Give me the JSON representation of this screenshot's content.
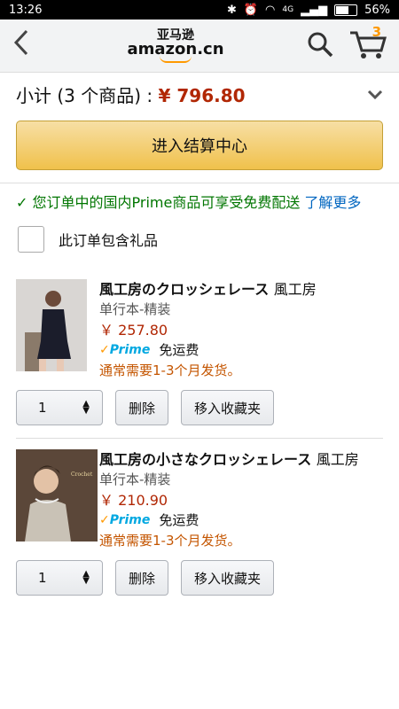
{
  "status": {
    "time": "13:26",
    "battery": "56%",
    "net": "4G"
  },
  "nav": {
    "logo_cn": "亚马逊",
    "logo_en": "amazon.cn",
    "cart_count": "3"
  },
  "subtotal": {
    "label": "小计 (3 个商品) : ",
    "amount": "¥ 796.80"
  },
  "checkout_label": "进入结算中心",
  "prime_note": {
    "text": "您订单中的国内Prime商品可享受免费配送",
    "link": "了解更多"
  },
  "gift_label": "此订单包含礼品",
  "items": [
    {
      "title": "風工房のクロッシェレース",
      "author": "風工房",
      "binding": "单行本-精装",
      "price": "￥ 257.80",
      "prime": "Prime",
      "shipping_free": "免运费",
      "ship_time": "通常需要1-3个月发货。",
      "qty": "1",
      "delete": "删除",
      "save": "移入收藏夹"
    },
    {
      "title": "風工房の小さなクロッシェレース",
      "author": "風工房",
      "binding": "单行本-精装",
      "price": "￥ 210.90",
      "prime": "Prime",
      "shipping_free": "免运费",
      "ship_time": "通常需要1-3个月发货。",
      "qty": "1",
      "delete": "删除",
      "save": "移入收藏夹"
    }
  ]
}
